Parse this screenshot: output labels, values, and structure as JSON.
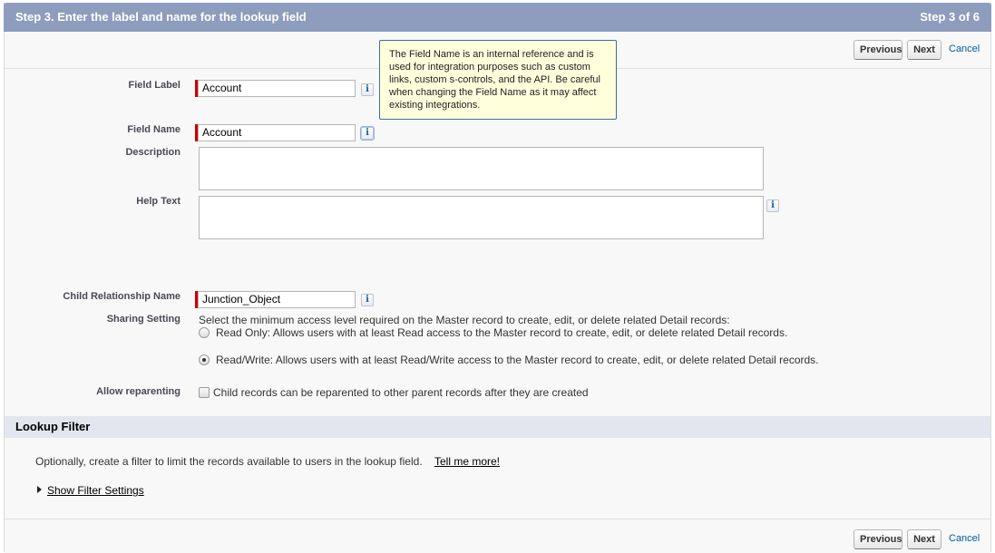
{
  "header": {
    "title": "Step 3. Enter the label and name for the lookup field",
    "step": "Step 3 of 6"
  },
  "buttons": {
    "previous": "Previous",
    "next": "Next",
    "cancel": "Cancel"
  },
  "tooltip": {
    "text": "The Field Name is an internal reference and is used for integration purposes such as custom links, custom s-controls, and the API. Be careful when changing the Field Name as it may affect existing integrations."
  },
  "form": {
    "field_label": {
      "label": "Field Label",
      "value": "Account"
    },
    "field_name": {
      "label": "Field Name",
      "value": "Account"
    },
    "description": {
      "label": "Description",
      "value": ""
    },
    "help_text": {
      "label": "Help Text",
      "value": ""
    },
    "child_relationship": {
      "label": "Child Relationship Name",
      "value": "Junction_Object"
    },
    "sharing": {
      "label": "Sharing Setting",
      "intro": "Select the minimum access level required on the Master record to create, edit, or delete related Detail records:",
      "options": [
        {
          "text": "Read Only: Allows users with at least Read access to the Master record to create, edit, or delete related Detail records.",
          "checked": false
        },
        {
          "text": "Read/Write: Allows users with at least Read/Write access to the Master record to create, edit, or delete related Detail records.",
          "checked": true
        }
      ]
    },
    "reparenting": {
      "label": "Allow reparenting",
      "text": "Child records can be reparented to other parent records after they are created",
      "checked": false
    },
    "info_icon": "i"
  },
  "lookup_filter": {
    "title": "Lookup Filter",
    "description": "Optionally, create a filter to limit the records available to users in the lookup field.",
    "tell_more": "Tell me more!",
    "show_settings": "Show Filter Settings"
  },
  "colors": {
    "header_bg": "#8e9dbe",
    "required": "#cc0000",
    "tooltip_bg": "#ffffdc",
    "link": "#015ba7"
  }
}
